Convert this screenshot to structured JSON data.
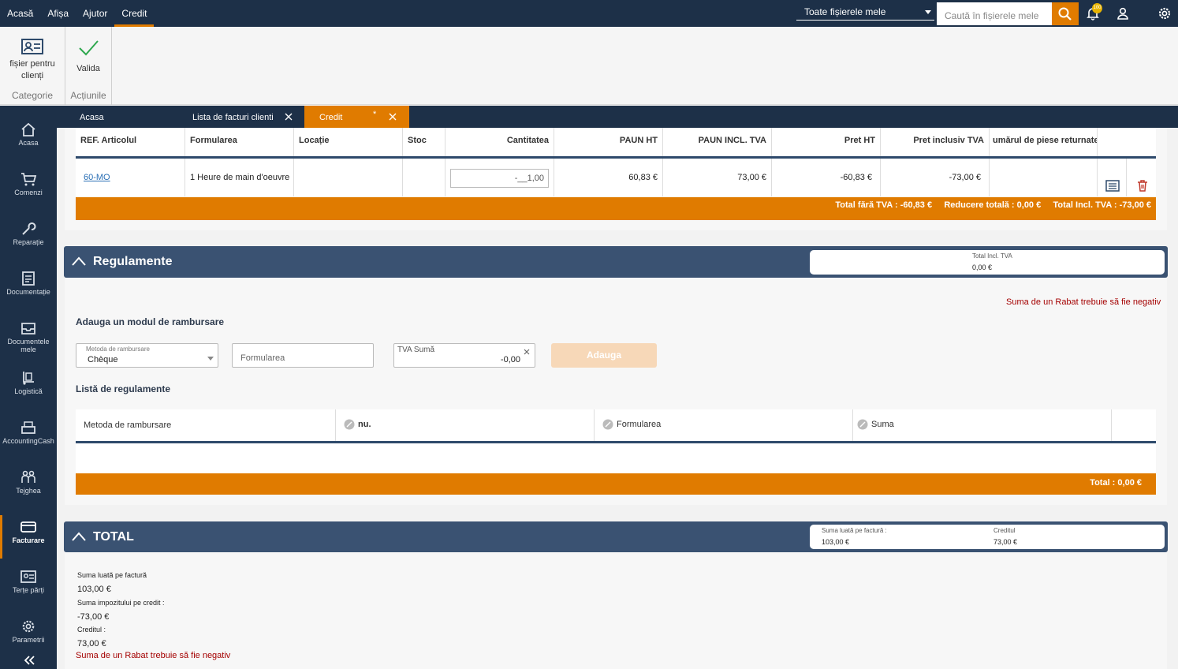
{
  "topbar": {
    "menu": [
      "Acasă",
      "Afișa",
      "Ajutor",
      "Credit"
    ],
    "scope_select": "Toate fișierele mele",
    "search_placeholder": "Caută în fișierele mele",
    "notif_count": "100"
  },
  "ribbon": {
    "customer_file": "fișier pentru clienți",
    "category_label": "Categorie",
    "validate": "Valida",
    "actions_label": "Acțiunile"
  },
  "sidebar": {
    "items": [
      "Acasa",
      "Comenzi",
      "Reparație",
      "Documentație",
      "Documentele mele",
      "Logistică",
      "AccountingCash",
      "Tejghea",
      "Facturare",
      "Terțe părți",
      "Parametrii"
    ]
  },
  "tabs": {
    "home": "Acasa",
    "invoices": "Lista de facturi clienti",
    "credit": "Credit",
    "dirty_mark": "*"
  },
  "lines": {
    "headers": [
      "REF. Articolul",
      "Formularea",
      "Locație",
      "Stoc",
      "Cantitatea",
      "PAUN HT",
      "PAUN INCL. TVA",
      "Pret HT",
      "Pret inclusiv TVA",
      "umărul de piese returnate"
    ],
    "row": {
      "ref": "60-MO",
      "label": "1 Heure de main d'oeuvre",
      "location": "",
      "stock": "",
      "qty": "-__1,00",
      "paun_ht": "60,83 €",
      "paun_ttc": "73,00 €",
      "price_ht": "-60,83 €",
      "price_ttc": "-73,00 €",
      "returned": ""
    },
    "totals": "Total fără TVA : -60,83 €     Reducere totală : 0,00 €     Total Incl. TVA : -73,00 €"
  },
  "payments": {
    "title": "Regulamente",
    "summary_label": "Total Incl. TVA",
    "summary_value": "0,00 €",
    "error": "Suma de un Rabat trebuie să fie negativ",
    "add_title": "Adauga un modul de rambursare",
    "method_label": "Metoda de rambursare",
    "method_value": "Chèque",
    "label_placeholder": "Formularea",
    "amount_label": "TVA Sumă",
    "amount_value": "-0,00",
    "add_button": "Adauga",
    "list_title": "Listă de regulamente",
    "columns": [
      "Metoda de rambursare",
      "nu.",
      "Formularea",
      "Suma"
    ],
    "total": "Total : 0,00 €"
  },
  "total_section": {
    "title": "TOTAL",
    "box_label1": "Suma luată pe factură :",
    "box_value1": "103,00 €",
    "box_label2": "Creditul",
    "box_value2": "73,00 €",
    "lines": [
      {
        "label": "Suma luată pe factură",
        "value": "103,00 €"
      },
      {
        "label": "Suma impozitului pe credit :",
        "value": "-73,00 €"
      },
      {
        "label": "Creditul :",
        "value": "73,00 €"
      }
    ],
    "error": "Suma de un Rabat trebuie să fie negativ"
  },
  "colors": {
    "navy": "#1d3048",
    "orange": "#e07b00",
    "section": "#3a5272",
    "error": "#a40000"
  }
}
